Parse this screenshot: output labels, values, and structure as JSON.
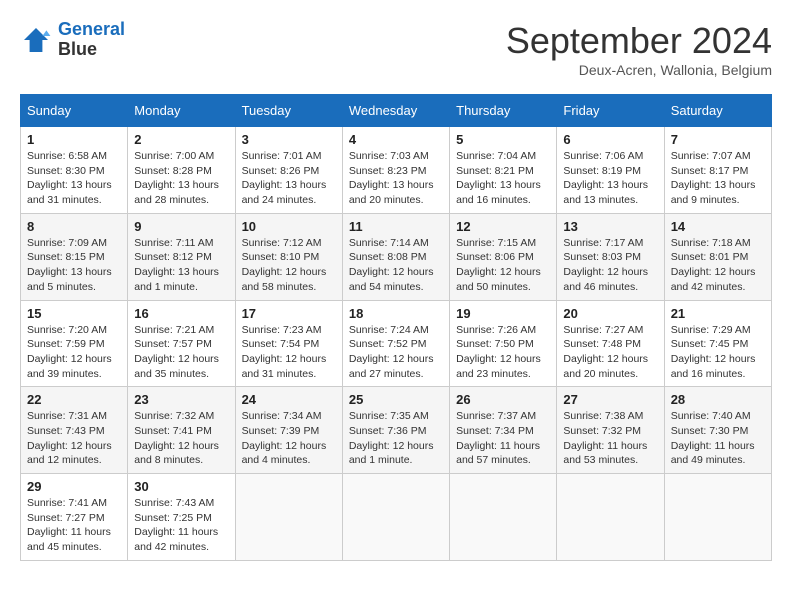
{
  "header": {
    "logo_line1": "General",
    "logo_line2": "Blue",
    "month_title": "September 2024",
    "subtitle": "Deux-Acren, Wallonia, Belgium"
  },
  "weekdays": [
    "Sunday",
    "Monday",
    "Tuesday",
    "Wednesday",
    "Thursday",
    "Friday",
    "Saturday"
  ],
  "weeks": [
    [
      {
        "day": "1",
        "info": "Sunrise: 6:58 AM\nSunset: 8:30 PM\nDaylight: 13 hours\nand 31 minutes."
      },
      {
        "day": "2",
        "info": "Sunrise: 7:00 AM\nSunset: 8:28 PM\nDaylight: 13 hours\nand 28 minutes."
      },
      {
        "day": "3",
        "info": "Sunrise: 7:01 AM\nSunset: 8:26 PM\nDaylight: 13 hours\nand 24 minutes."
      },
      {
        "day": "4",
        "info": "Sunrise: 7:03 AM\nSunset: 8:23 PM\nDaylight: 13 hours\nand 20 minutes."
      },
      {
        "day": "5",
        "info": "Sunrise: 7:04 AM\nSunset: 8:21 PM\nDaylight: 13 hours\nand 16 minutes."
      },
      {
        "day": "6",
        "info": "Sunrise: 7:06 AM\nSunset: 8:19 PM\nDaylight: 13 hours\nand 13 minutes."
      },
      {
        "day": "7",
        "info": "Sunrise: 7:07 AM\nSunset: 8:17 PM\nDaylight: 13 hours\nand 9 minutes."
      }
    ],
    [
      {
        "day": "8",
        "info": "Sunrise: 7:09 AM\nSunset: 8:15 PM\nDaylight: 13 hours\nand 5 minutes."
      },
      {
        "day": "9",
        "info": "Sunrise: 7:11 AM\nSunset: 8:12 PM\nDaylight: 13 hours\nand 1 minute."
      },
      {
        "day": "10",
        "info": "Sunrise: 7:12 AM\nSunset: 8:10 PM\nDaylight: 12 hours\nand 58 minutes."
      },
      {
        "day": "11",
        "info": "Sunrise: 7:14 AM\nSunset: 8:08 PM\nDaylight: 12 hours\nand 54 minutes."
      },
      {
        "day": "12",
        "info": "Sunrise: 7:15 AM\nSunset: 8:06 PM\nDaylight: 12 hours\nand 50 minutes."
      },
      {
        "day": "13",
        "info": "Sunrise: 7:17 AM\nSunset: 8:03 PM\nDaylight: 12 hours\nand 46 minutes."
      },
      {
        "day": "14",
        "info": "Sunrise: 7:18 AM\nSunset: 8:01 PM\nDaylight: 12 hours\nand 42 minutes."
      }
    ],
    [
      {
        "day": "15",
        "info": "Sunrise: 7:20 AM\nSunset: 7:59 PM\nDaylight: 12 hours\nand 39 minutes."
      },
      {
        "day": "16",
        "info": "Sunrise: 7:21 AM\nSunset: 7:57 PM\nDaylight: 12 hours\nand 35 minutes."
      },
      {
        "day": "17",
        "info": "Sunrise: 7:23 AM\nSunset: 7:54 PM\nDaylight: 12 hours\nand 31 minutes."
      },
      {
        "day": "18",
        "info": "Sunrise: 7:24 AM\nSunset: 7:52 PM\nDaylight: 12 hours\nand 27 minutes."
      },
      {
        "day": "19",
        "info": "Sunrise: 7:26 AM\nSunset: 7:50 PM\nDaylight: 12 hours\nand 23 minutes."
      },
      {
        "day": "20",
        "info": "Sunrise: 7:27 AM\nSunset: 7:48 PM\nDaylight: 12 hours\nand 20 minutes."
      },
      {
        "day": "21",
        "info": "Sunrise: 7:29 AM\nSunset: 7:45 PM\nDaylight: 12 hours\nand 16 minutes."
      }
    ],
    [
      {
        "day": "22",
        "info": "Sunrise: 7:31 AM\nSunset: 7:43 PM\nDaylight: 12 hours\nand 12 minutes."
      },
      {
        "day": "23",
        "info": "Sunrise: 7:32 AM\nSunset: 7:41 PM\nDaylight: 12 hours\nand 8 minutes."
      },
      {
        "day": "24",
        "info": "Sunrise: 7:34 AM\nSunset: 7:39 PM\nDaylight: 12 hours\nand 4 minutes."
      },
      {
        "day": "25",
        "info": "Sunrise: 7:35 AM\nSunset: 7:36 PM\nDaylight: 12 hours\nand 1 minute."
      },
      {
        "day": "26",
        "info": "Sunrise: 7:37 AM\nSunset: 7:34 PM\nDaylight: 11 hours\nand 57 minutes."
      },
      {
        "day": "27",
        "info": "Sunrise: 7:38 AM\nSunset: 7:32 PM\nDaylight: 11 hours\nand 53 minutes."
      },
      {
        "day": "28",
        "info": "Sunrise: 7:40 AM\nSunset: 7:30 PM\nDaylight: 11 hours\nand 49 minutes."
      }
    ],
    [
      {
        "day": "29",
        "info": "Sunrise: 7:41 AM\nSunset: 7:27 PM\nDaylight: 11 hours\nand 45 minutes."
      },
      {
        "day": "30",
        "info": "Sunrise: 7:43 AM\nSunset: 7:25 PM\nDaylight: 11 hours\nand 42 minutes."
      },
      {
        "day": "",
        "info": ""
      },
      {
        "day": "",
        "info": ""
      },
      {
        "day": "",
        "info": ""
      },
      {
        "day": "",
        "info": ""
      },
      {
        "day": "",
        "info": ""
      }
    ]
  ]
}
